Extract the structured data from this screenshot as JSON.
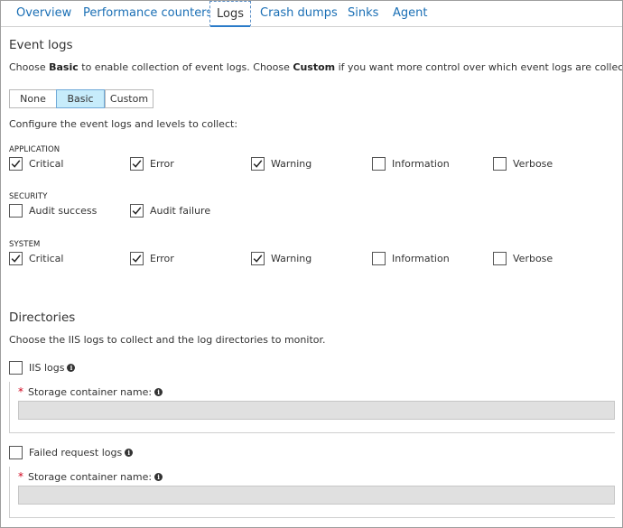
{
  "tabs": [
    {
      "label": "Overview",
      "active": false
    },
    {
      "label": "Performance counters",
      "active": false
    },
    {
      "label": "Logs",
      "active": true
    },
    {
      "label": "Crash dumps",
      "active": false
    },
    {
      "label": "Sinks",
      "active": false
    },
    {
      "label": "Agent",
      "active": false
    }
  ],
  "event_logs": {
    "title": "Event logs",
    "description_parts": [
      "Choose ",
      "Basic",
      " to enable collection of event logs. Choose ",
      "Custom",
      " if you want more control over which event logs are collected."
    ],
    "mode_options": [
      "None",
      "Basic",
      "Custom"
    ],
    "selected_mode": "Basic",
    "configure_text": "Configure the event logs and levels to collect:",
    "groups": [
      {
        "name": "APPLICATION",
        "levels": [
          {
            "label": "Critical",
            "checked": true
          },
          {
            "label": "Error",
            "checked": true
          },
          {
            "label": "Warning",
            "checked": true
          },
          {
            "label": "Information",
            "checked": false
          },
          {
            "label": "Verbose",
            "checked": false
          }
        ]
      },
      {
        "name": "SECURITY",
        "levels": [
          {
            "label": "Audit success",
            "checked": false
          },
          {
            "label": "Audit failure",
            "checked": true
          }
        ]
      },
      {
        "name": "SYSTEM",
        "levels": [
          {
            "label": "Critical",
            "checked": true
          },
          {
            "label": "Error",
            "checked": true
          },
          {
            "label": "Warning",
            "checked": true
          },
          {
            "label": "Information",
            "checked": false
          },
          {
            "label": "Verbose",
            "checked": false
          }
        ]
      }
    ]
  },
  "directories": {
    "title": "Directories",
    "description": "Choose the IIS logs to collect and the log directories to monitor.",
    "iis_logs": {
      "label": "IIS logs",
      "checked": false,
      "storage_label": "Storage container name:",
      "required_mark": "*",
      "value": ""
    },
    "failed_request_logs": {
      "label": "Failed request logs",
      "checked": false,
      "storage_label": "Storage container name:",
      "required_mark": "*",
      "value": ""
    }
  },
  "icons": {
    "info": "info-icon",
    "check": "checkmark-icon"
  },
  "colors": {
    "link": "#1a6fb5",
    "selected_segment": "#c7ecfb",
    "required": "#d0021b",
    "disabled_input": "#e0e0e0"
  }
}
